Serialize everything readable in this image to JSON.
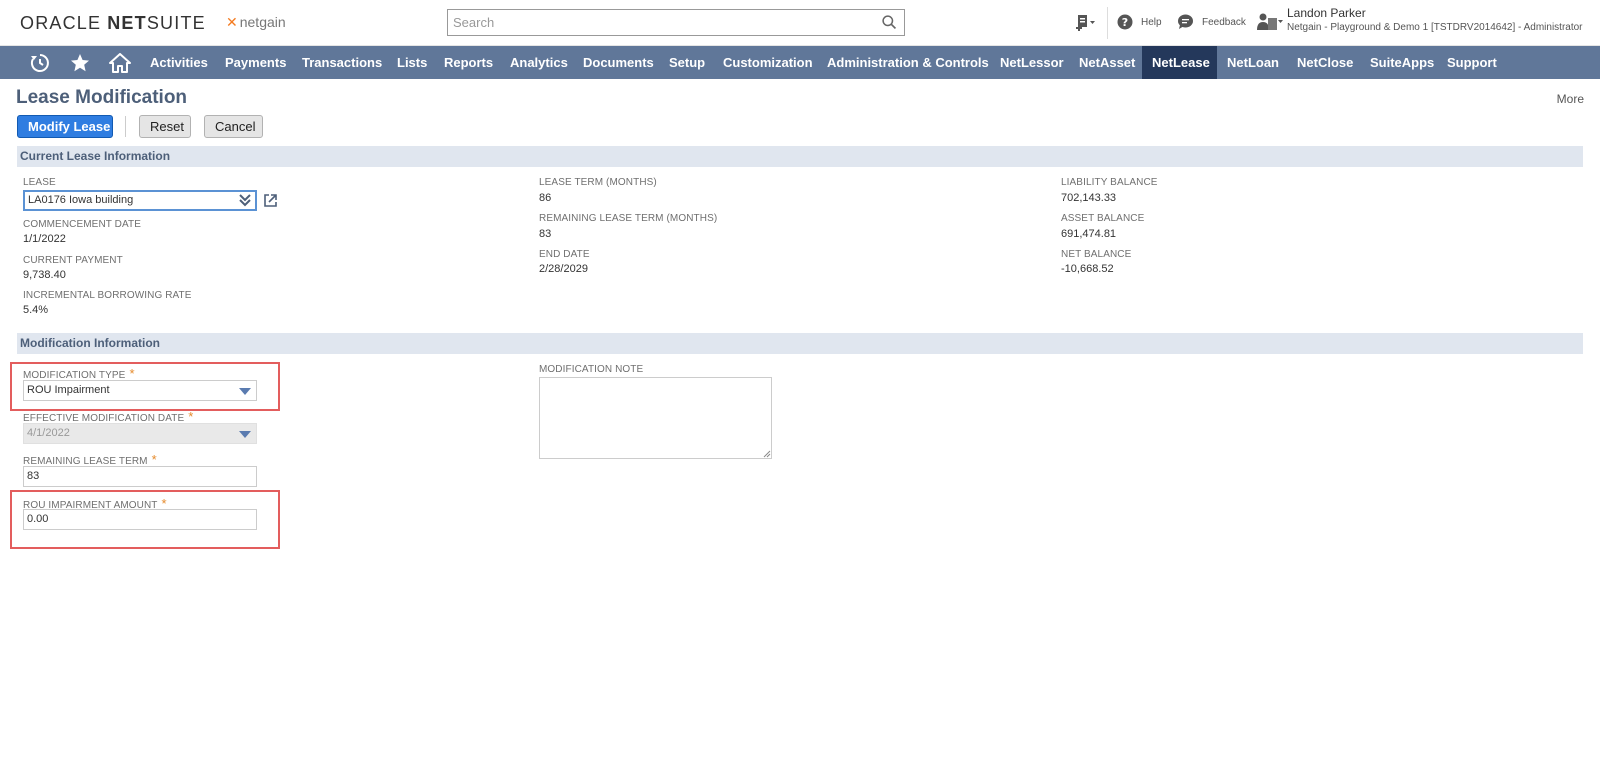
{
  "header": {
    "brand_oracle": "ORACLE",
    "brand_net": "NET",
    "brand_suite": "SUITE",
    "partner": "netgain",
    "search_placeholder": "Search",
    "help_label": "Help",
    "feedback_label": "Feedback",
    "user_name": "Landon Parker",
    "user_account": "Netgain - Playground & Demo 1 [TSTDRV2014642] - Administrator"
  },
  "nav": {
    "icons": [
      "recent-icon",
      "star-icon",
      "home-icon"
    ],
    "items": [
      {
        "label": "Activities"
      },
      {
        "label": "Payments"
      },
      {
        "label": "Transactions"
      },
      {
        "label": "Lists"
      },
      {
        "label": "Reports"
      },
      {
        "label": "Analytics"
      },
      {
        "label": "Documents"
      },
      {
        "label": "Setup"
      },
      {
        "label": "Customization"
      },
      {
        "label": "Administration & Controls"
      },
      {
        "label": "NetLessor"
      },
      {
        "label": "NetAsset"
      },
      {
        "label": "NetLease",
        "active": true
      },
      {
        "label": "NetLoan"
      },
      {
        "label": "NetClose"
      },
      {
        "label": "SuiteApps"
      },
      {
        "label": "Support"
      }
    ]
  },
  "page": {
    "title": "Lease Modification",
    "more": "More",
    "buttons": {
      "modify": "Modify Lease",
      "reset": "Reset",
      "cancel": "Cancel"
    }
  },
  "current": {
    "section_title": "Current Lease Information",
    "lease_label": "LEASE",
    "lease_value": "LA0176 Iowa building",
    "commencement_label": "COMMENCEMENT DATE",
    "commencement_value": "1/1/2022",
    "current_payment_label": "CURRENT PAYMENT",
    "current_payment_value": "9,738.40",
    "ibr_label": "INCREMENTAL BORROWING RATE",
    "ibr_value": "5.4%",
    "lease_term_label": "LEASE TERM (MONTHS)",
    "lease_term_value": "86",
    "remaining_term_label": "REMAINING LEASE TERM (MONTHS)",
    "remaining_term_value": "83",
    "end_date_label": "END DATE",
    "end_date_value": "2/28/2029",
    "liability_label": "LIABILITY BALANCE",
    "liability_value": "702,143.33",
    "asset_label": "ASSET BALANCE",
    "asset_value": "691,474.81",
    "net_label": "NET BALANCE",
    "net_value": "-10,668.52"
  },
  "modification": {
    "section_title": "Modification Information",
    "type_label": "MODIFICATION TYPE",
    "type_value": "ROU Impairment",
    "effective_label": "EFFECTIVE MODIFICATION DATE",
    "effective_value": "4/1/2022",
    "remaining_label": "REMAINING LEASE TERM",
    "remaining_value": "83",
    "impairment_label": "ROU IMPAIRMENT AMOUNT",
    "impairment_value": "0.00",
    "note_label": "MODIFICATION NOTE",
    "note_value": "",
    "required_mark": "*"
  },
  "colors": {
    "nav_bg": "#607799",
    "nav_active": "#24385b",
    "primary_button": "#2f7de1",
    "section_bg": "#e0e6ef",
    "highlight": "#e35d5d",
    "required": "#e58a2b"
  }
}
